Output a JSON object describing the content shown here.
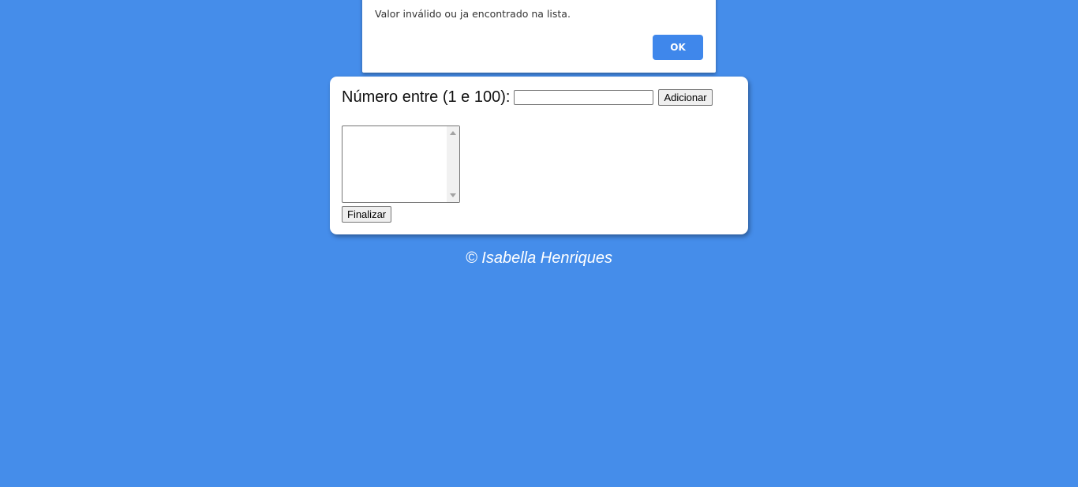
{
  "alert": {
    "message": "Valor inválido ou ja encontrado na lista.",
    "ok_label": "OK",
    "ok_color": "#3f87eb"
  },
  "form": {
    "label": "Número entre (1 e 100):",
    "input_value": "",
    "add_button_label": "Adicionar",
    "list_items": [],
    "finish_button_label": "Finalizar"
  },
  "footer": {
    "text": "© Isabella Henriques"
  },
  "colors": {
    "background": "#458dea",
    "card": "#ffffff",
    "footer_text": "#ffffff"
  },
  "icons": {
    "scroll_up": "scroll-up-arrow-icon",
    "scroll_down": "scroll-down-arrow-icon"
  }
}
